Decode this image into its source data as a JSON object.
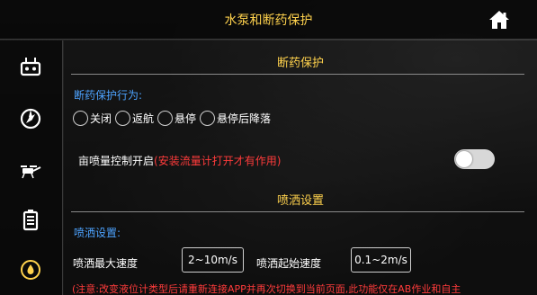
{
  "header": {
    "title": "水泵和断药保护",
    "home_icon": "home-icon"
  },
  "sidebar": {
    "items": [
      {
        "name": "remote-controller-icon"
      },
      {
        "name": "compass-icon"
      },
      {
        "name": "drone-sprayer-icon"
      },
      {
        "name": "battery-icon"
      },
      {
        "name": "droplet-circle-icon"
      }
    ]
  },
  "section1": {
    "title": "断药保护",
    "behavior_label": "断药保护行为:",
    "options": [
      "关闭",
      "返航",
      "悬停",
      "悬停后降落"
    ],
    "flow_label": "亩喷量控制开启",
    "flow_note": "(安装流量计打开才有作用)",
    "flow_toggle_on": false
  },
  "section2": {
    "title": "喷洒设置",
    "settings_label": "喷洒设置:",
    "max_speed_label": "喷洒最大速度",
    "max_speed_placeholder": "2~10m/s",
    "start_speed_label": "喷洒起始速度",
    "start_speed_placeholder": "0.1~2m/s",
    "note": "(注意:改变液位计类型后请重新连接APP并再次切换到当前页面,此功能仅在AB作业和自主"
  },
  "colors": {
    "accent": "#ffd24d",
    "link": "#4da3ff",
    "warning": "#ff3b3b"
  }
}
